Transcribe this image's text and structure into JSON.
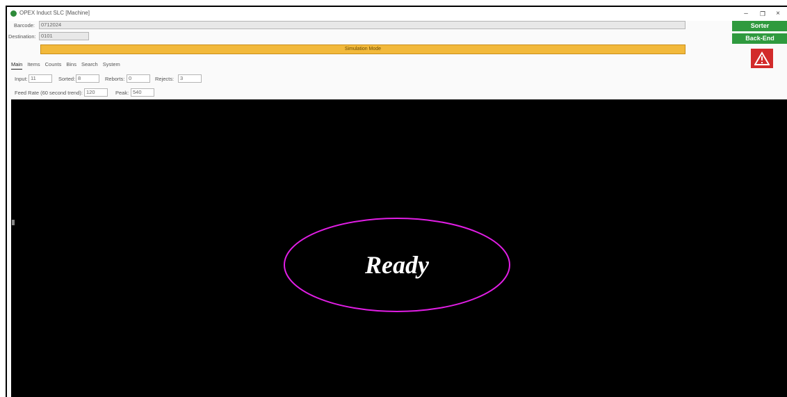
{
  "window": {
    "title": "OPEX Induct SLC [Machine]",
    "minimize_label": "–",
    "maximize_label": "❐",
    "close_label": "×"
  },
  "barcode": {
    "label": "Barcode:",
    "value": "0712024"
  },
  "destination": {
    "label": "Destination:",
    "value": "0101"
  },
  "mode_banner": "Simulation Mode",
  "side_buttons": {
    "sorter": "Sorter",
    "back_end": "Back-End",
    "warning_icon": "warning-triangle-icon"
  },
  "tabs": [
    {
      "label": "Main",
      "active": true
    },
    {
      "label": "Items",
      "active": false
    },
    {
      "label": "Counts",
      "active": false
    },
    {
      "label": "Bins",
      "active": false
    },
    {
      "label": "Search",
      "active": false
    },
    {
      "label": "System",
      "active": false
    }
  ],
  "stats": {
    "input": {
      "label": "Input:",
      "value": "11"
    },
    "sorted": {
      "label": "Sorted:",
      "value": "8"
    },
    "reborts": {
      "label": "Reborts:",
      "value": "0"
    },
    "rejects": {
      "label": "Rejects:",
      "value": "3"
    },
    "feed_rate": {
      "label": "Feed Rate (60 second trend):",
      "value": "120"
    },
    "peak": {
      "label": "Peak:",
      "value": "540"
    }
  },
  "status_panel": {
    "text": "Ready",
    "colors": {
      "background": "#000000",
      "text": "#ffffff",
      "highlight_ellipse": "#e21ee6"
    }
  },
  "colors": {
    "accent_green": "#2f9a3e",
    "mode_banner": "#f2b93b",
    "warning_red": "#d22b2b"
  }
}
